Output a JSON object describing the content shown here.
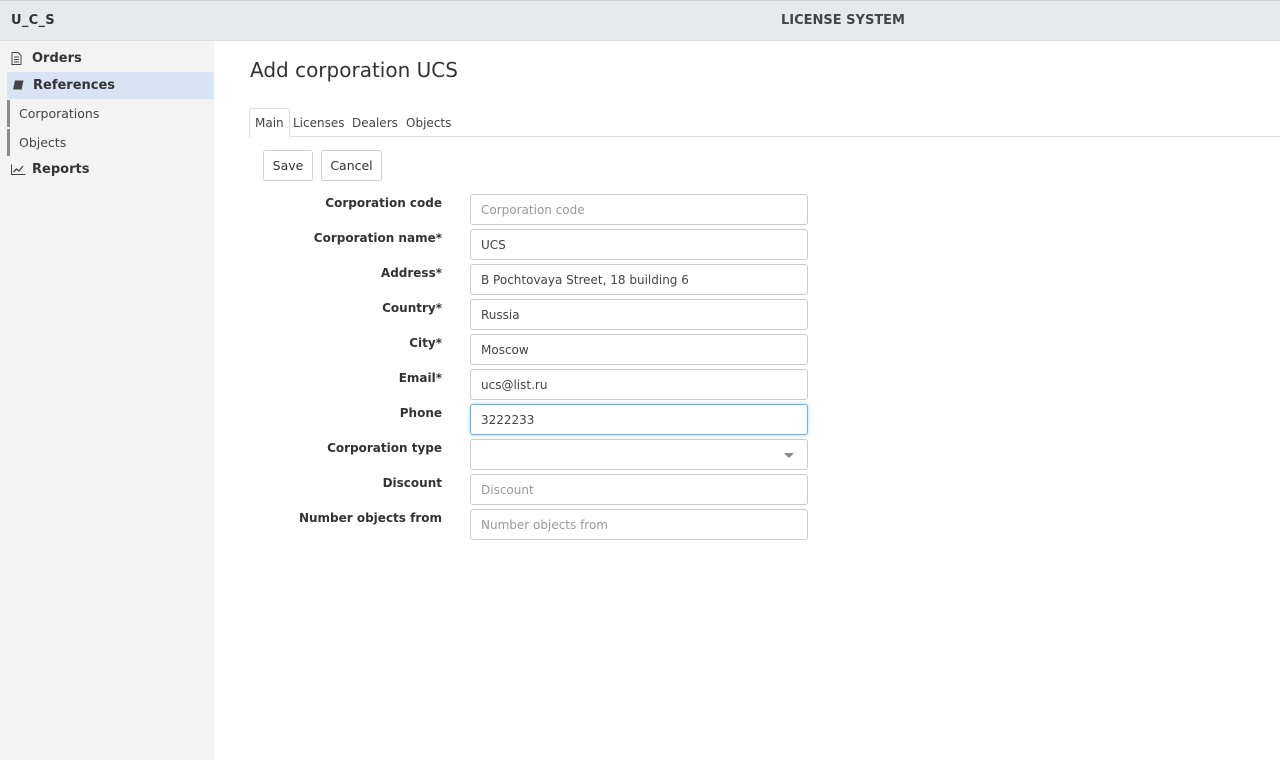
{
  "app": {
    "brand": "U_C_S",
    "system_title": "LICENSE SYSTEM"
  },
  "sidebar": {
    "items": [
      {
        "label": "Orders",
        "icon": "document-icon"
      },
      {
        "label": "References",
        "icon": "book-icon",
        "active": true
      },
      {
        "label": "Reports",
        "icon": "line-chart-icon"
      }
    ],
    "subitems": [
      {
        "label": "Corporations"
      },
      {
        "label": "Objects"
      }
    ]
  },
  "page": {
    "title": "Add corporation UCS"
  },
  "tabs": [
    {
      "label": "Main",
      "active": true
    },
    {
      "label": "Licenses"
    },
    {
      "label": "Dealers"
    },
    {
      "label": "Objects"
    }
  ],
  "buttons": {
    "save": "Save",
    "cancel": "Cancel"
  },
  "form": {
    "fields": [
      {
        "label": "Corporation code",
        "value": "",
        "placeholder": "Corporation code"
      },
      {
        "label": "Corporation name*",
        "value": "UCS",
        "placeholder": ""
      },
      {
        "label": "Address*",
        "value": "B Pochtovaya Street, 18 building 6",
        "placeholder": ""
      },
      {
        "label": "Country*",
        "value": "Russia",
        "placeholder": ""
      },
      {
        "label": "City*",
        "value": "Moscow",
        "placeholder": ""
      },
      {
        "label": "Email*",
        "value": "ucs@list.ru",
        "placeholder": ""
      },
      {
        "label": "Phone",
        "value": "3222233",
        "placeholder": ""
      },
      {
        "label": "Corporation type",
        "value": "",
        "placeholder": ""
      },
      {
        "label": "Discount",
        "value": "",
        "placeholder": "Discount"
      },
      {
        "label": "Number objects from",
        "value": "",
        "placeholder": "Number objects from"
      }
    ]
  },
  "colors": {
    "sidebar_bg": "#f3f3f4",
    "active_nav": "#d8e3f3",
    "focus_border": "#66afe9"
  }
}
